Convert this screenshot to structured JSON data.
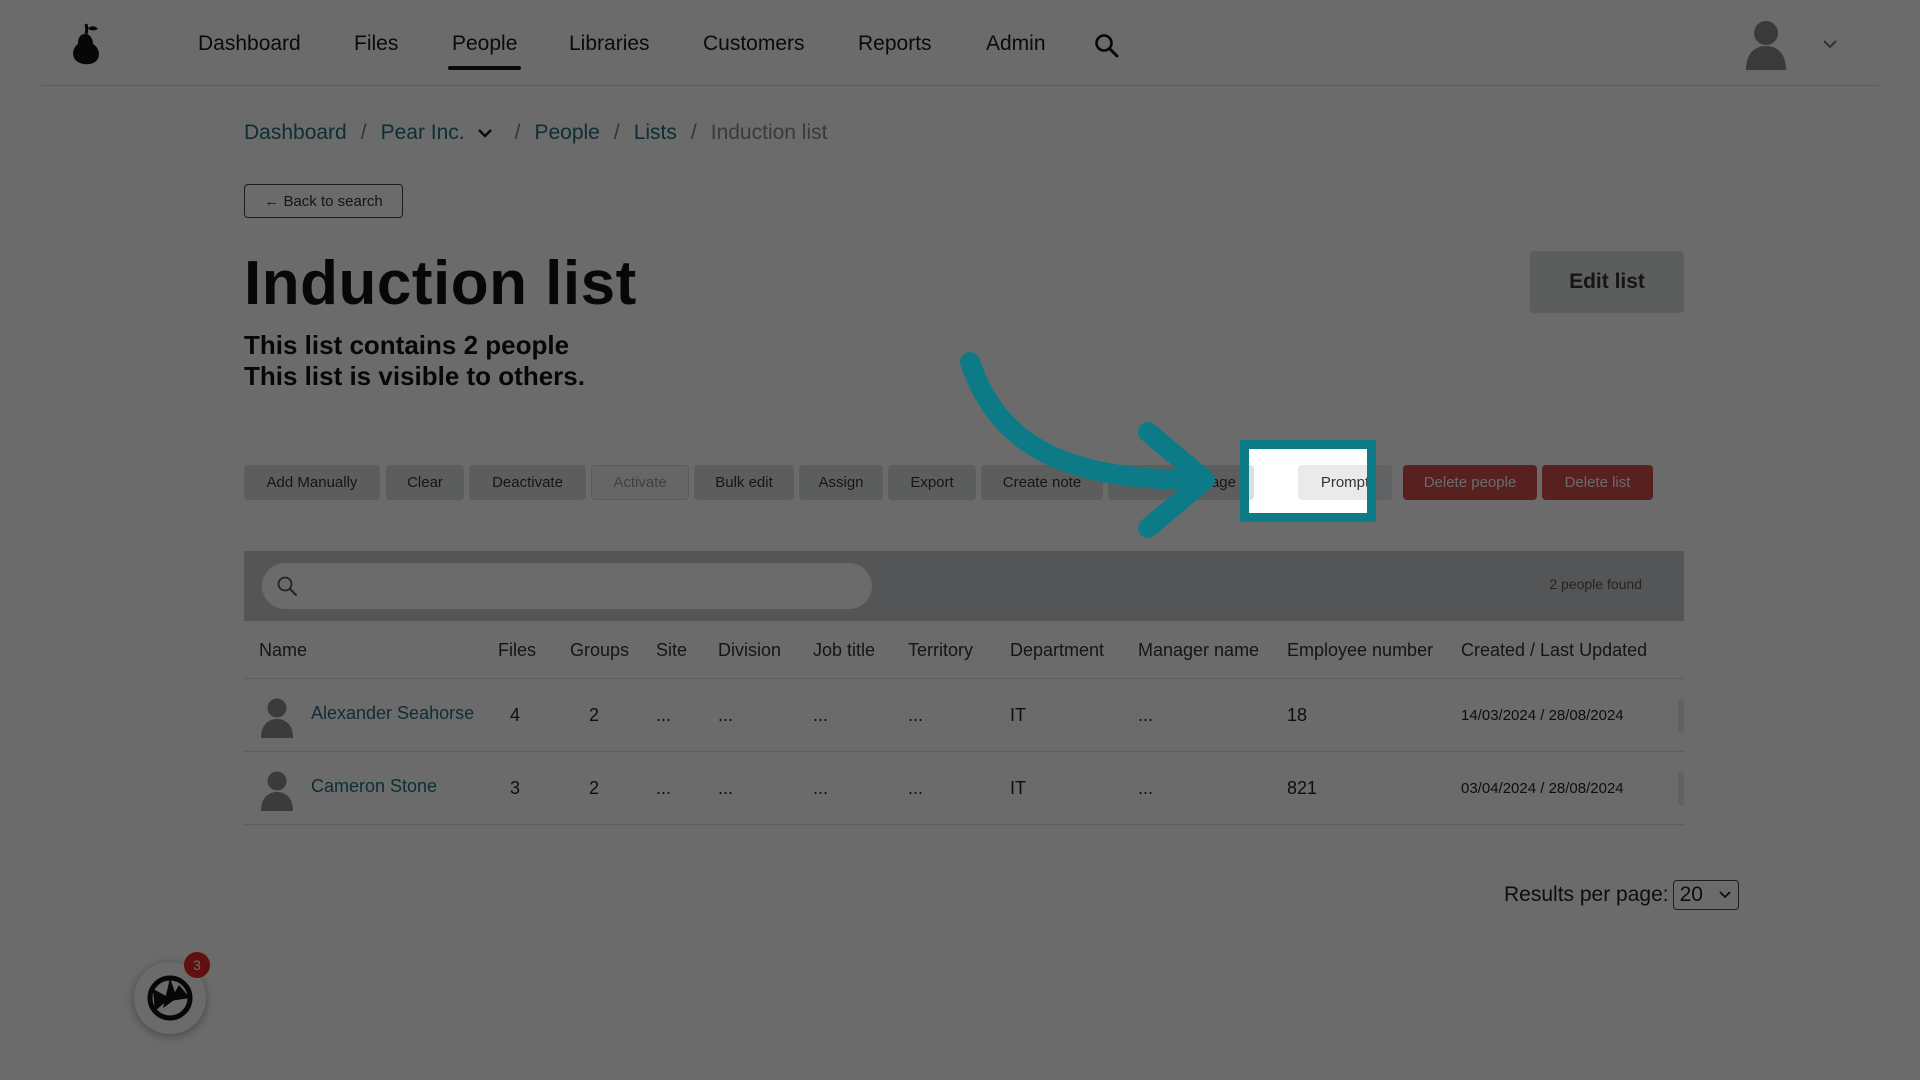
{
  "nav": {
    "items": [
      {
        "label": "Dashboard"
      },
      {
        "label": "Files"
      },
      {
        "label": "People",
        "active": true
      },
      {
        "label": "Libraries"
      },
      {
        "label": "Customers"
      },
      {
        "label": "Reports"
      },
      {
        "label": "Admin"
      }
    ]
  },
  "breadcrumb": {
    "dashboard": "Dashboard",
    "org": "Pear Inc.",
    "people": "People",
    "lists": "Lists",
    "current": "Induction list",
    "separator": "/"
  },
  "back_button": "← Back to search",
  "page": {
    "title": "Induction list",
    "count_text": "This list contains 2 people",
    "visibility_text": "This list is visible to others.",
    "edit_button": "Edit list"
  },
  "actions": {
    "add_manually": "Add Manually",
    "clear": "Clear",
    "deactivate": "Deactivate",
    "activate": "Activate",
    "bulk_edit": "Bulk edit",
    "assign": "Assign",
    "export": "Export",
    "create_note": "Create note",
    "message": "sage",
    "prompt": "Prompt",
    "delete_people": "Delete people",
    "delete_list": "Delete list"
  },
  "search": {
    "placeholder": "",
    "results_text": "2 people found"
  },
  "table": {
    "headers": {
      "name": "Name",
      "files": "Files",
      "groups": "Groups",
      "site": "Site",
      "division": "Division",
      "job_title": "Job title",
      "territory": "Territory",
      "department": "Department",
      "manager": "Manager name",
      "employee_number": "Employee number",
      "dates": "Created / Last Updated"
    },
    "rows": [
      {
        "name": "Alexander Seahorse",
        "files": "4",
        "groups": "2",
        "site": "...",
        "division": "...",
        "job_title": "...",
        "territory": "...",
        "department": "IT",
        "manager": "...",
        "employee_number": "18",
        "dates": "14/03/2024 / 28/08/2024"
      },
      {
        "name": "Cameron Stone",
        "files": "3",
        "groups": "2",
        "site": "...",
        "division": "...",
        "job_title": "...",
        "territory": "...",
        "department": "IT",
        "manager": "...",
        "employee_number": "821",
        "dates": "03/04/2024 / 28/08/2024"
      }
    ]
  },
  "pagination": {
    "label": "Results per page:",
    "value": "20"
  },
  "help_widget": {
    "badge_count": "3"
  },
  "colors": {
    "accent": "#0d7a87",
    "link": "#1f6f7a",
    "danger": "#d24d4b"
  }
}
